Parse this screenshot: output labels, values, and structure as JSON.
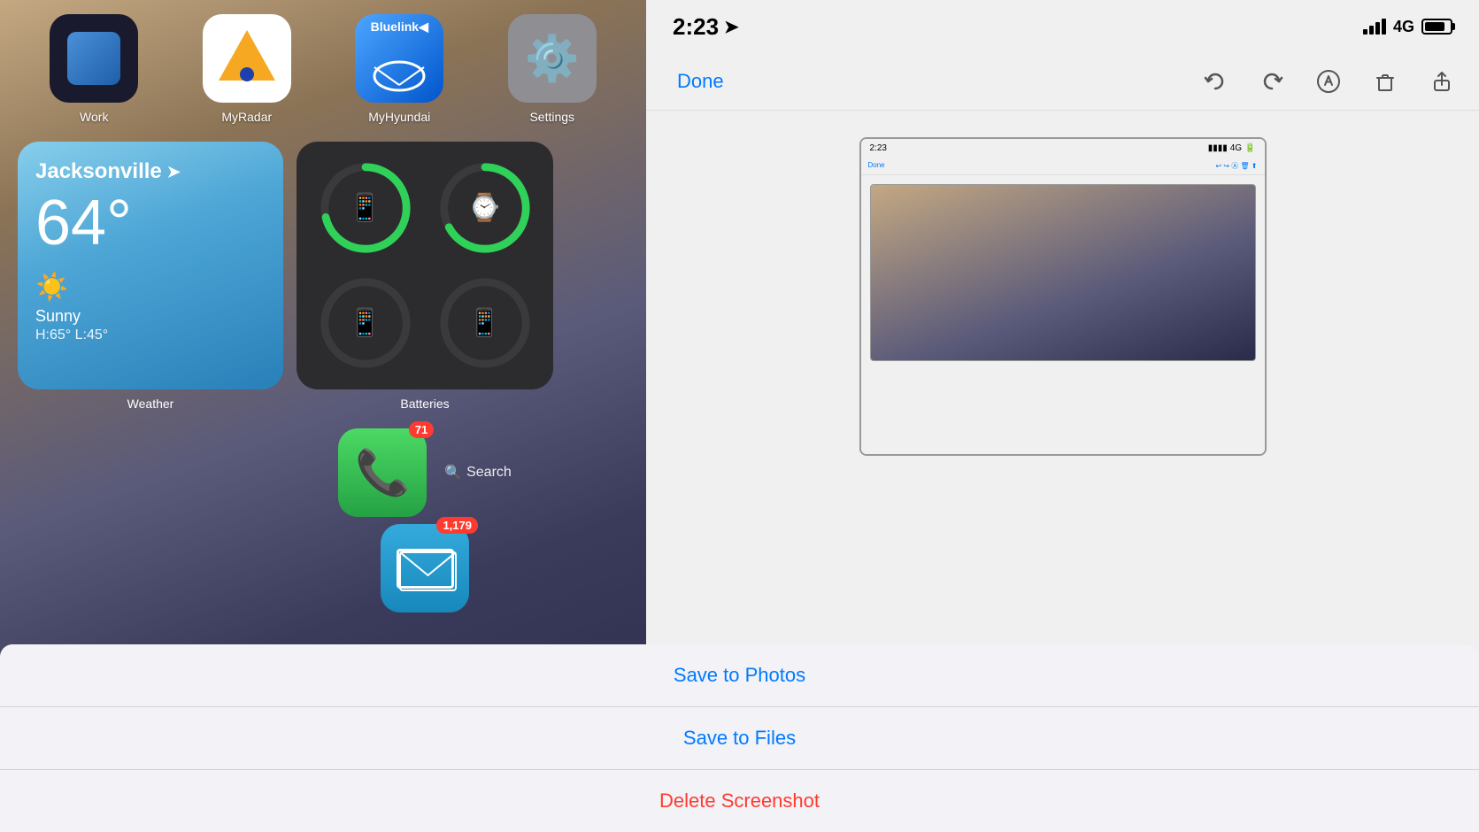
{
  "left": {
    "apps_top": [
      {
        "label": "Work",
        "icon_type": "work"
      },
      {
        "label": "MyRadar",
        "icon_type": "myradar"
      },
      {
        "label": "MyHyundai",
        "icon_type": "bluelink"
      },
      {
        "label": "Settings",
        "icon_type": "settings"
      }
    ],
    "weather": {
      "city": "Jacksonville",
      "temp": "64°",
      "condition": "Sunny",
      "high": "H:65°",
      "low": "L:45°",
      "label": "Weather"
    },
    "batteries": {
      "label": "Batteries",
      "items": [
        {
          "icon": "📱",
          "charge": 85
        },
        {
          "icon": "⌚",
          "charge": 80
        },
        {
          "icon": "📱",
          "charge": 0
        },
        {
          "icon": "📱",
          "charge": 0
        }
      ]
    },
    "phone": {
      "badge": "71",
      "label": ""
    },
    "search": {
      "label": "Search",
      "icon": "🔍"
    },
    "mail": {
      "badge": "1,179",
      "label": ""
    },
    "safari": {
      "label": ""
    }
  },
  "right": {
    "status_bar": {
      "time": "2:23",
      "location_arrow": "➤",
      "signal": "4G"
    },
    "toolbar": {
      "done_label": "Done",
      "icons": [
        "undo",
        "redo",
        "markup",
        "delete",
        "share"
      ]
    },
    "action_sheet": {
      "items": [
        {
          "label": "Save to Photos",
          "color": "blue"
        },
        {
          "label": "Save to Files",
          "color": "blue"
        },
        {
          "label": "Delete Screenshot",
          "color": "red"
        }
      ]
    },
    "mini_status": {
      "time": "2:23",
      "signal": "4G"
    },
    "mini_toolbar": {
      "done": "Done"
    }
  }
}
